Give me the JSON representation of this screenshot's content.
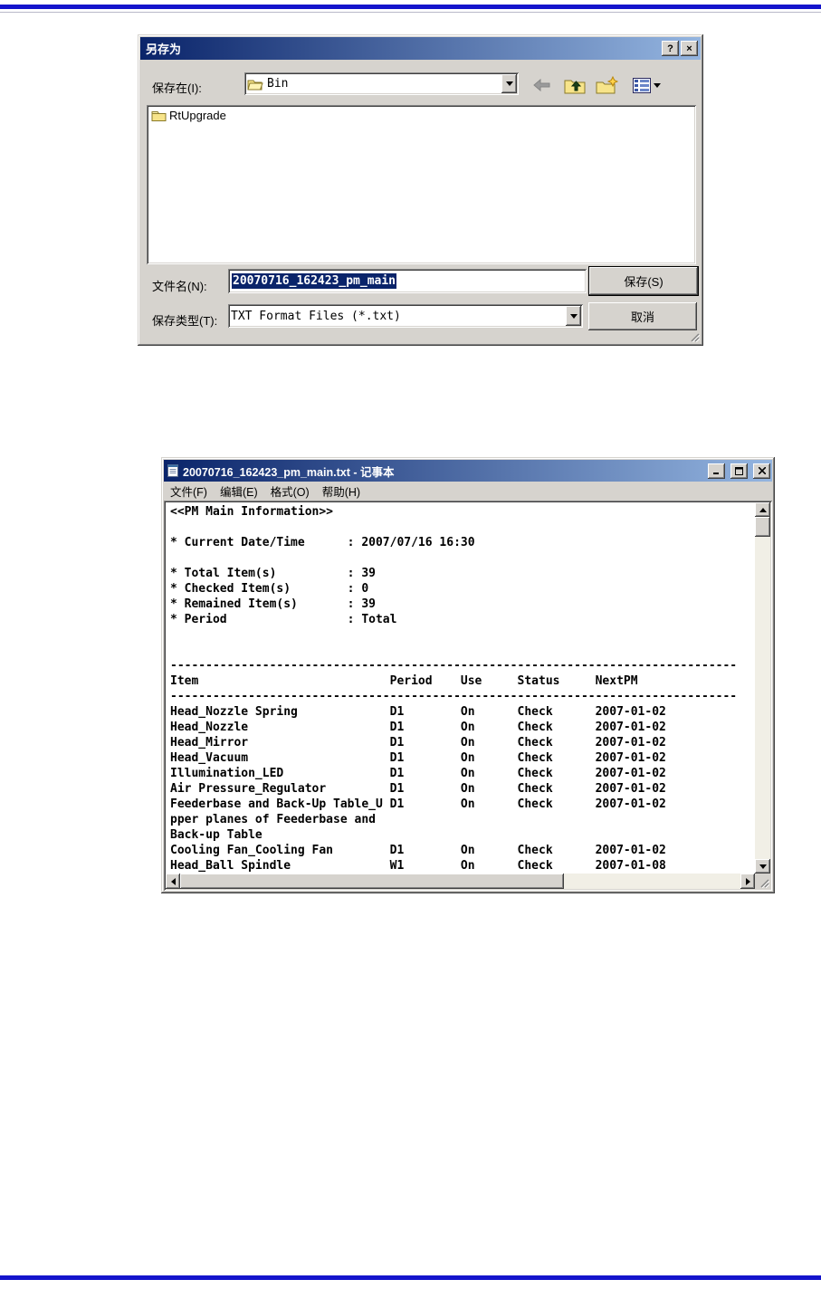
{
  "page": {
    "top_rule_color": "#1414cc",
    "bottom_rule_color": "#1414cc"
  },
  "colors": {
    "titlebar_gradient_start": "#0a246a",
    "titlebar_gradient_end": "#94b5e0",
    "dialog_face": "#d6d3ce",
    "selection_background": "#0a246a",
    "selection_text": "#ffffff"
  },
  "save_as_dialog": {
    "title": "另存为",
    "titlebar": {
      "help_button": "?",
      "close_button": "×"
    },
    "save_in": {
      "label": "保存在(I):",
      "value": "Bin"
    },
    "toolbar_icons": [
      "back-arrow",
      "up-one-level-folder",
      "new-folder",
      "view-menu"
    ],
    "file_list": [
      {
        "icon": "folder",
        "name": "RtUpgrade"
      }
    ],
    "file_name": {
      "label": "文件名(N):",
      "value": "20070716_162423_pm_main",
      "selected": true
    },
    "file_type": {
      "label": "保存类型(T):",
      "value": "TXT Format Files (*.txt)"
    },
    "buttons": {
      "save": "保存(S)",
      "cancel": "取消"
    }
  },
  "notepad": {
    "title": "20070716_162423_pm_main.txt - 记事本",
    "window_buttons": {
      "minimize_icon": "minimize",
      "maximize_icon": "maximize",
      "close_icon": "close"
    },
    "menu": [
      {
        "label": "文件(F)"
      },
      {
        "label": "编辑(E)"
      },
      {
        "label": "格式(O)"
      },
      {
        "label": "帮助(H)"
      }
    ],
    "content_text": "<<PM Main Information>>\n\n* Current Date/Time      : 2007/07/16 16:30\n\n* Total Item(s)          : 39\n* Checked Item(s)        : 0\n* Remained Item(s)       : 39\n* Period                 : Total\n\n\n--------------------------------------------------------------------------------\nItem                           Period    Use     Status     NextPM\n--------------------------------------------------------------------------------\nHead_Nozzle Spring             D1        On      Check      2007-01-02\nHead_Nozzle                    D1        On      Check      2007-01-02\nHead_Mirror                    D1        On      Check      2007-01-02\nHead_Vacuum                    D1        On      Check      2007-01-02\nIllumination_LED               D1        On      Check      2007-01-02\nAir Pressure_Regulator         D1        On      Check      2007-01-02\nFeederbase and Back-Up Table_U D1        On      Check      2007-01-02\npper planes of Feederbase and\nBack-up Table\nCooling Fan_Cooling Fan        D1        On      Check      2007-01-02\nHead_Ball Spindle              W1        On      Check      2007-01-08",
    "report": {
      "header": "<<PM Main Information>>",
      "current_datetime": "2007/07/16 16:30",
      "total_items": "39",
      "checked_items": "0",
      "remained_items": "39",
      "period": "Total",
      "table": {
        "columns": [
          "Item",
          "Period",
          "Use",
          "Status",
          "NextPM"
        ],
        "rows": [
          [
            "Head_Nozzle Spring",
            "D1",
            "On",
            "Check",
            "2007-01-02"
          ],
          [
            "Head_Nozzle",
            "D1",
            "On",
            "Check",
            "2007-01-02"
          ],
          [
            "Head_Mirror",
            "D1",
            "On",
            "Check",
            "2007-01-02"
          ],
          [
            "Head_Vacuum",
            "D1",
            "On",
            "Check",
            "2007-01-02"
          ],
          [
            "Illumination_LED",
            "D1",
            "On",
            "Check",
            "2007-01-02"
          ],
          [
            "Air Pressure_Regulator",
            "D1",
            "On",
            "Check",
            "2007-01-02"
          ],
          [
            "Feederbase and Back-Up Table_Upper planes of Feederbase and Back-up Table",
            "D1",
            "On",
            "Check",
            "2007-01-02"
          ],
          [
            "Cooling Fan_Cooling Fan",
            "D1",
            "On",
            "Check",
            "2007-01-02"
          ],
          [
            "Head_Ball Spindle",
            "W1",
            "On",
            "Check",
            "2007-01-08"
          ]
        ]
      }
    }
  }
}
